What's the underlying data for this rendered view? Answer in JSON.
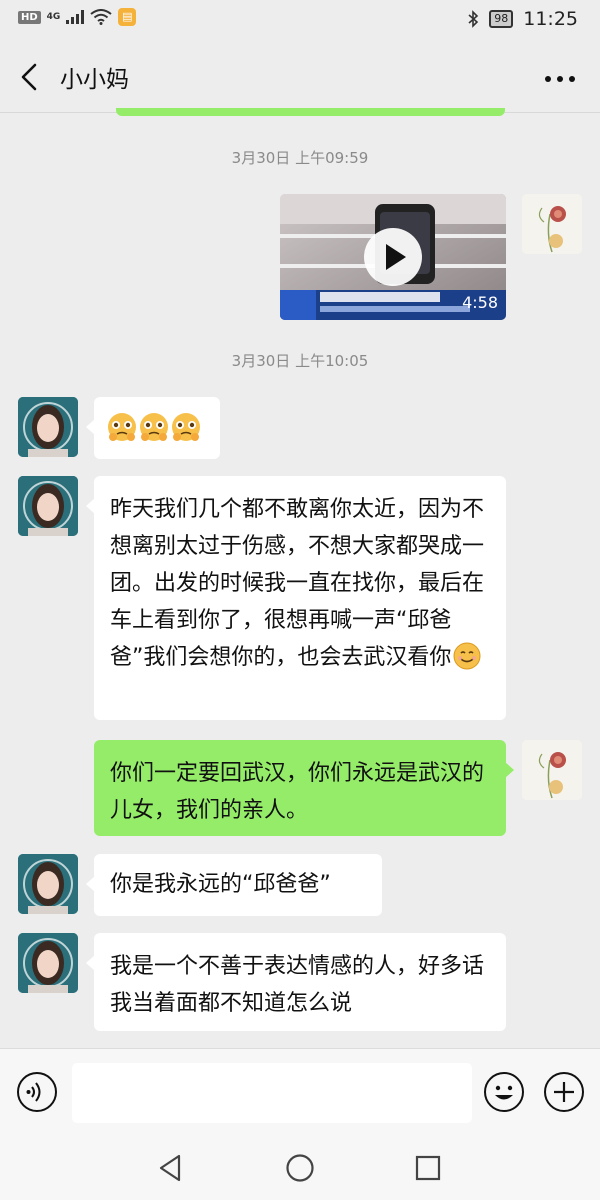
{
  "status_bar": {
    "hd": "HD",
    "network": "4G",
    "battery": "98",
    "time": "11:25"
  },
  "header": {
    "title": "小小妈"
  },
  "messages": {
    "ts1": "3月30日 上午09:59",
    "video_duration": "4:58",
    "ts2": "3月30日 上午10:05",
    "m2_text": "昨天我们几个都不敢离你太近，因为不想离别太过于伤感，不想大家都哭成一团。出发的时候我一直在找你，最后在车上看到你了，很想再喊一声“邱爸爸”我们会想你的，也会去武汉看你",
    "m3_text": "你们一定要回武汉，你们永远是武汉的儿女，我们的亲人。",
    "m4_text": "你是我永远的“邱爸爸”",
    "m5_text": "我是一个不善于表达情感的人，好多话我当着面都不知道怎么说"
  },
  "colors": {
    "sent_bubble": "#95ec69",
    "received_bubble": "#ffffff",
    "background": "#ededed"
  },
  "icons": {
    "back": "chevron-left-icon",
    "more": "more-dots-icon",
    "voice": "voice-icon",
    "emoji": "emoji-icon",
    "plus": "plus-icon"
  }
}
